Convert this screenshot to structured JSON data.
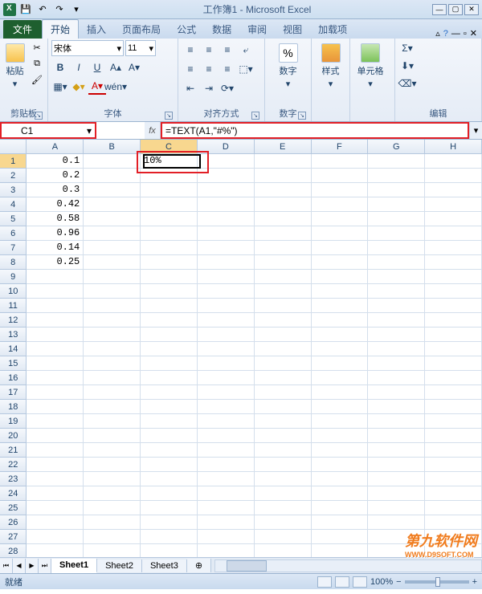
{
  "window": {
    "title": "工作簿1 - Microsoft Excel"
  },
  "tabs": {
    "file": "文件",
    "list": [
      "开始",
      "插入",
      "页面布局",
      "公式",
      "数据",
      "审阅",
      "视图",
      "加载项"
    ],
    "active": "开始"
  },
  "ribbon": {
    "clipboard": {
      "label": "剪贴板",
      "paste": "粘贴"
    },
    "font": {
      "label": "字体",
      "name": "宋体",
      "size": "11",
      "bold": "B",
      "ital": "I",
      "und": "U"
    },
    "align": {
      "label": "对齐方式"
    },
    "number": {
      "label": "数字",
      "btn": "数字",
      "pct": "%"
    },
    "styles": {
      "label": "样式",
      "btn": "样式"
    },
    "cells": {
      "label": "单元格",
      "btn": "单元格"
    },
    "editing": {
      "label": "编辑",
      "sigma": "Σ"
    }
  },
  "formula": {
    "cell_ref": "C1",
    "fx": "fx",
    "value": "=TEXT(A1,\"#%\")"
  },
  "grid": {
    "columns": [
      "A",
      "B",
      "C",
      "D",
      "E",
      "F",
      "G",
      "H"
    ],
    "active_col": "C",
    "active_row": 1,
    "row_count": 28,
    "col_a": [
      "0.1",
      "0.2",
      "0.3",
      "0.42",
      "0.58",
      "0.96",
      "0.14",
      "0.25"
    ],
    "c1": "10%"
  },
  "sheets": {
    "list": [
      "Sheet1",
      "Sheet2",
      "Sheet3"
    ],
    "active": "Sheet1"
  },
  "status": {
    "ready": "就绪",
    "zoom": "100%",
    "minus": "−",
    "plus": "+"
  },
  "watermark": {
    "line1": "第九软件网",
    "line2": "WWW.D9SOFT.COM"
  }
}
